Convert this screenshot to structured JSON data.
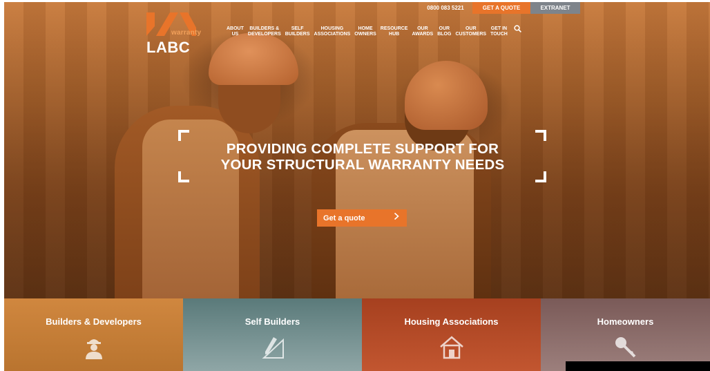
{
  "brand": {
    "logo_sub": "warranty",
    "logo_main": "LABC",
    "accent": "#e8742a"
  },
  "topbar": {
    "phone": "0800 083 5221",
    "quote_label": "GET A QUOTE",
    "extranet_label": "EXTRANET"
  },
  "nav": {
    "items": [
      "ABOUT\nUS",
      "BUILDERS &\nDEVELOPERS",
      "SELF\nBUILDERS",
      "HOUSING\nASSOCIATIONS",
      "HOME\nOWNERS",
      "RESOURCE\nHUB",
      "OUR\nAWARDS",
      "OUR\nBLOG",
      "OUR\nCUSTOMERS",
      "GET IN\nTOUCH"
    ],
    "search_icon": "search-icon"
  },
  "hero": {
    "headline_1": "PROVIDING COMPLETE SUPPORT FOR",
    "headline_2": "YOUR STRUCTURAL WARRANTY NEEDS",
    "cta_label": "Get a quote",
    "cta_icon": "chevron-right-icon"
  },
  "categories": [
    {
      "label": "Builders & Developers",
      "icon": "construction-worker-icon"
    },
    {
      "label": "Self Builders",
      "icon": "pencil-ruler-icon"
    },
    {
      "label": "Housing Associations",
      "icon": "house-icon"
    },
    {
      "label": "Homeowners",
      "icon": "key-icon"
    }
  ]
}
